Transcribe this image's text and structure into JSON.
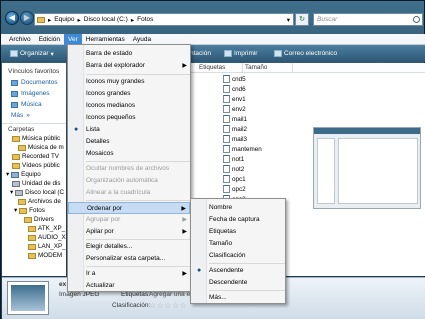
{
  "address": {
    "segments": [
      "Equipo",
      "Disco local (C:)",
      "Fotos"
    ]
  },
  "search": {
    "placeholder": "Buscar"
  },
  "menubar": [
    "Archivo",
    "Edición",
    "Ver",
    "Herramientas",
    "Ayuda"
  ],
  "toolbar": {
    "organize": "Organizar",
    "slideshow_partial": "ntación",
    "print": "Imprimir",
    "email": "Correo electrónico"
  },
  "left_pane": {
    "favorites_title": "Vínculos favoritos",
    "favorites": [
      "Documentos",
      "Imágenes",
      "Música",
      "Más"
    ],
    "folders_title": "Carpetas",
    "tree": [
      "Música públic",
      "Música de m",
      "Recorded TV",
      "Vídeos públic",
      "Equipo",
      "Unidad de dis",
      "Disco local (C",
      "Archivos de",
      "Fotos",
      "Drivers",
      "ATK_XP_",
      "AUDIO_X",
      "LAN_XP_",
      "MODEM"
    ]
  },
  "columns": [
    "Etiquetas",
    "Tamaño"
  ],
  "files": [
    "cnd5",
    "cnd6",
    "env1",
    "env2",
    "mail1",
    "mail2",
    "mail3",
    "mantemen",
    "not1",
    "not2",
    "opc1",
    "opc2",
    "opc3"
  ],
  "details": {
    "filename_partial": "ex",
    "type": "Imagen JPEG",
    "tags_label": "Etiquetas:",
    "tags_value": "Agregar una et",
    "rating_label": "Clasificación:",
    "stars": "☆☆☆☆☆"
  },
  "view_menu": {
    "items": [
      "Barra de estado",
      "Barra del explorador",
      "Iconos muy grandes",
      "Iconos grandes",
      "Iconos medianos",
      "Iconos pequeños",
      "Lista",
      "Detalles",
      "Mosaicos",
      "Ocultar nombres de archivos",
      "Organización automática",
      "Alinear a la cuadrícula",
      "Ordenar por",
      "Agrupar por",
      "Apilar por",
      "Elegir detalles...",
      "Personalizar esta carpeta...",
      "Ir a",
      "Actualizar"
    ],
    "checked": "Lista",
    "highlighted": "Ordenar por"
  },
  "sort_menu": {
    "items": [
      "Nombre",
      "Fecha de captura",
      "Etiquetas",
      "Tamaño",
      "Clasificación",
      "Ascendente",
      "Descendente",
      "Más..."
    ],
    "checked": "Ascendente"
  }
}
